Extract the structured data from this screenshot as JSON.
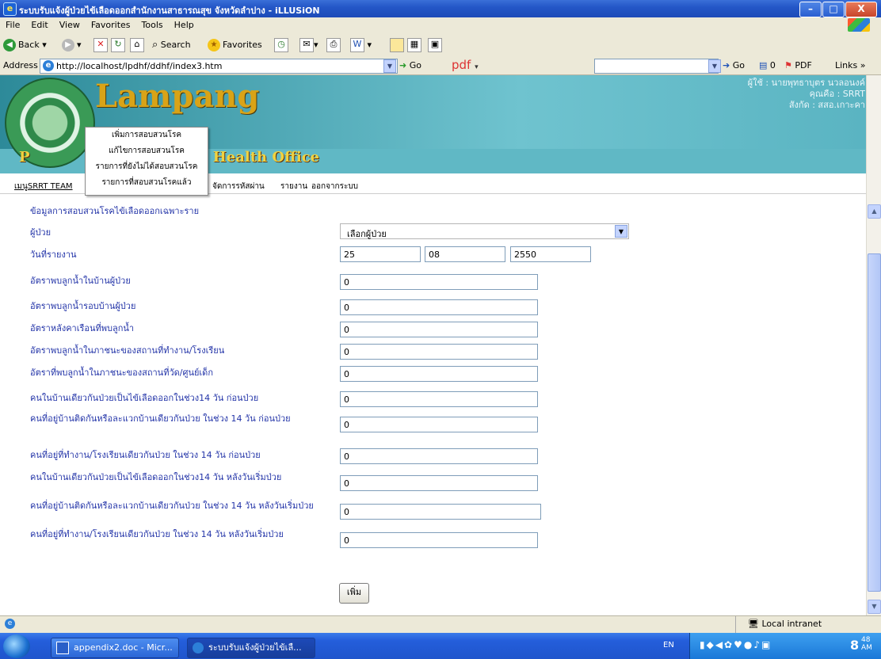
{
  "window": {
    "title": "ระบบรับแจ้งผู้ป่วยไข้เลือดออกสำนักงานสาธารณสุข จังหวัดลำปาง - iLLUSiON",
    "buttons": {
      "minimize": "–",
      "maximize": "□",
      "close": "X"
    }
  },
  "menubar": [
    "File",
    "Edit",
    "View",
    "Favorites",
    "Tools",
    "Help"
  ],
  "toolbar": {
    "back": "Back",
    "search": "Search",
    "favorites": "Favorites"
  },
  "addressbar": {
    "label": "Address",
    "url": "http://localhost/lpdhf/ddhf/index3.htm",
    "go": "Go",
    "pdf": "pdf",
    "go2": "Go",
    "count": "0",
    "pdf2": "PDF",
    "links": "Links"
  },
  "banner": {
    "title": "Lampang",
    "subtitle_left": "P",
    "subtitle_right": "c Health Office",
    "user_line1": "ผู้ใช้ : นายพุทธาบุตร นวลอนงค์",
    "user_line2": "คุณคือ : SRRT",
    "user_line3": "สังกัด : สสอ.เกาะคา"
  },
  "nav": {
    "menu": "เมนูSRRT TEAM",
    "password": "จัดการรหัสผ่าน",
    "report": "รายงาน",
    "logout": "ออกจากระบบ"
  },
  "dropdown": [
    "เพิ่มการสอบสวนโรค",
    "แก้ไขการสอบสวนโรค",
    "รายการที่ยังไม่ได้สอบสวนโรค",
    "รายการที่สอบสวนโรคแล้ว"
  ],
  "form": {
    "heading": "ข้อมูลการสอบสวนโรคไข้เลือดออกเฉพาะราย",
    "patient_label": "ผู้ป่วย",
    "patient_select": "เลือกผู้ป่วย",
    "date_label": "วันที่รายงาน",
    "date_day": "25",
    "date_month": "08",
    "date_year": "2550",
    "fields": [
      {
        "label": "อัตราพบลูกน้ำในบ้านผู้ป่วย",
        "value": "0"
      },
      {
        "label": "อัตราพบลูกน้ำรอบบ้านผู้ป่วย",
        "value": "0"
      },
      {
        "label": "อัตราหลังคาเรือนที่พบลูกน้ำ",
        "value": "0"
      },
      {
        "label": "อัตราพบลูกน้ำในภาชนะของสถานที่ทำงาน/โรงเรียน",
        "value": "0"
      },
      {
        "label": "อัตราที่พบลูกน้ำในภาชนะของสถานที่วัด/ศูนย์เด็ก",
        "value": "0"
      },
      {
        "label": "คนในบ้านเดียวกันป่วยเป็นไข้เลือดออกในช่วง14 วัน ก่อนป่วย",
        "value": "0"
      },
      {
        "label": "คนที่อยู่บ้านติดกันหรือละแวกบ้านเดียวกันป่วย ในช่วง 14 วัน ก่อนป่วย",
        "value": "0"
      },
      {
        "label": "คนที่อยู่ที่ทำงาน/โรงเรียนเดียวกันป่วย ในช่วง 14 วัน ก่อนป่วย",
        "value": "0"
      },
      {
        "label": "คนในบ้านเดียวกันป่วยเป็นไข้เลือดออกในช่วง14 วัน หลังวันเริ่มป่วย",
        "value": "0"
      },
      {
        "label": "คนที่อยู่บ้านติดกันหรือละแวกบ้านเดียวกันป่วย ในช่วง 14 วัน หลังวันเริ่มป่วย",
        "value": "0"
      },
      {
        "label": "คนที่อยู่ที่ทำงาน/โรงเรียนเดียวกันป่วย ในช่วง 14 วัน หลังวันเริ่มป่วย",
        "value": "0"
      }
    ],
    "submit": "เพิ่ม"
  },
  "statusbar": {
    "zone": "Local intranet"
  },
  "taskbar": {
    "task1": "appendix2.doc - Micr...",
    "task2": "ระบบรับแจ้งผู้ป่วยไข้เลื...",
    "lang": "EN",
    "clock": "8",
    "clock_min": "48",
    "clock_ampm": "AM"
  },
  "colors": {
    "link": "#2334a8",
    "banner": "#4fa9b8",
    "titlebar": "#2457c7"
  }
}
